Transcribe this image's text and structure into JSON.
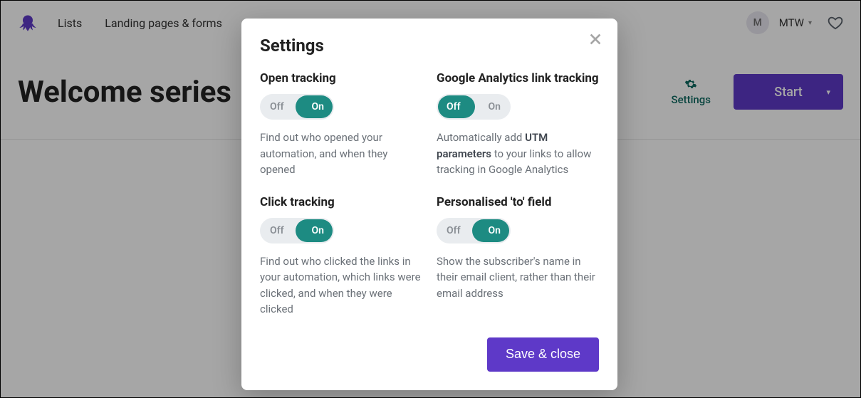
{
  "nav": {
    "links": [
      "Lists",
      "Landing pages & forms"
    ],
    "workspace_initial": "M",
    "workspace_name": "MTW"
  },
  "page": {
    "title": "Welcome series",
    "settings_label": "Settings",
    "start_label": "Start"
  },
  "modal": {
    "title": "Settings",
    "toggle_off": "Off",
    "toggle_on": "On",
    "save_label": "Save & close",
    "blocks": {
      "open_tracking": {
        "title": "Open tracking",
        "state": "on",
        "desc": "Find out who opened your automation, and when they opened"
      },
      "click_tracking": {
        "title": "Click tracking",
        "state": "on",
        "desc": "Find out who clicked the links in your automation, which links were clicked, and when they were clicked"
      },
      "ga_tracking": {
        "title": "Google Analytics link tracking",
        "state": "off",
        "desc_prefix": "Automatically add ",
        "desc_strong": "UTM parameters",
        "desc_suffix": " to your links to allow tracking in Google Analytics"
      },
      "personalised_to": {
        "title": "Personalised 'to' field",
        "state": "on",
        "desc": "Show the subscriber's name in their email client, rather than their email address"
      }
    }
  }
}
